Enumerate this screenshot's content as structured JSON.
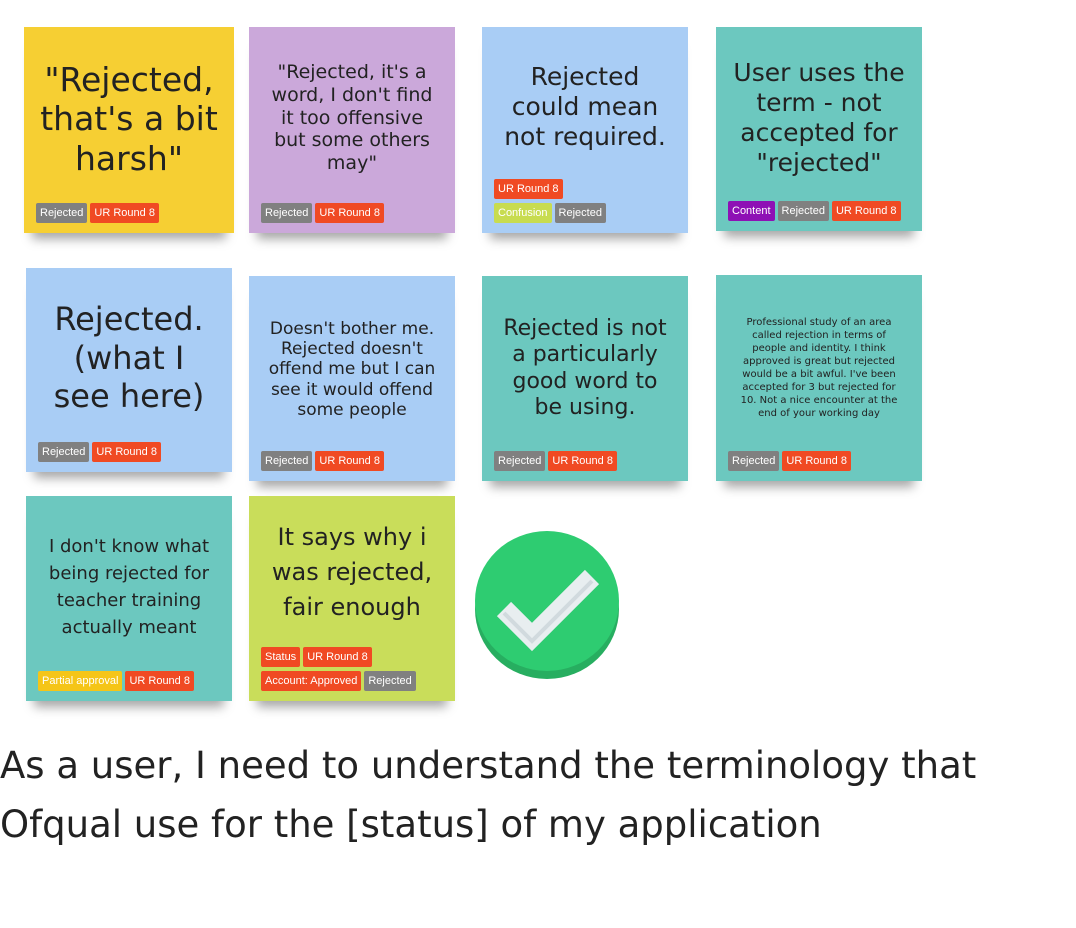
{
  "colors": {
    "Rejected": "#808080",
    "UR Round 8": "#f04a23",
    "Confusion": "#c8dc50",
    "Content": "#8e10b5",
    "Partial approval": "#f5c518",
    "Status": "#f04a23",
    "Account: Approved": "#f04a23"
  },
  "notes": [
    {
      "text": "\"Rejected, that's a bit harsh\"",
      "tags": [
        [
          "Rejected",
          "UR Round 8"
        ]
      ]
    },
    {
      "text": "\"Rejected, it's a word, I don't find it too offensive but some others may\"",
      "tags": [
        [
          "Rejected",
          "UR Round 8"
        ]
      ]
    },
    {
      "text": "Rejected could mean not required.",
      "tags": [
        [
          "UR Round 8"
        ],
        [
          "Confusion",
          "Rejected"
        ]
      ]
    },
    {
      "text": "User uses the term - not accepted for \"rejected\"",
      "tags": [
        [
          "Content",
          "Rejected",
          "UR Round 8"
        ]
      ]
    },
    {
      "text": "Rejected. (what I see here)",
      "tags": [
        [
          "Rejected",
          "UR Round 8"
        ]
      ]
    },
    {
      "text": "Doesn't bother me. Rejected doesn't offend me but I can see it would offend some people",
      "tags": [
        [
          "Rejected",
          "UR Round 8"
        ]
      ]
    },
    {
      "text": "Rejected is not a particularly good word to be using.",
      "tags": [
        [
          "Rejected",
          "UR Round 8"
        ]
      ]
    },
    {
      "text": "Professional study of an area called rejection in terms of people and identity. I think approved is great but rejected would be a bit awful. I've been accepted for 3 but rejected for 10. Not a nice encounter at the end of your working day",
      "tags": [
        [
          "Rejected",
          "UR Round 8"
        ]
      ]
    },
    {
      "text": "I don't know what being rejected for teacher training actually meant",
      "tags": [
        [
          "Partial approval",
          "UR Round 8"
        ]
      ]
    },
    {
      "text": "It says why i was rejected, fair enough",
      "tags": [
        [
          "Status",
          "UR Round 8"
        ],
        [
          "Account: Approved",
          "Rejected"
        ]
      ]
    }
  ],
  "checkmark": {
    "icon": "checkmark-icon",
    "color": "#2ecc71"
  },
  "story": {
    "line1": "As a user, I need to understand the terminology that",
    "line2": "Ofqual use for the [status] of my application"
  }
}
